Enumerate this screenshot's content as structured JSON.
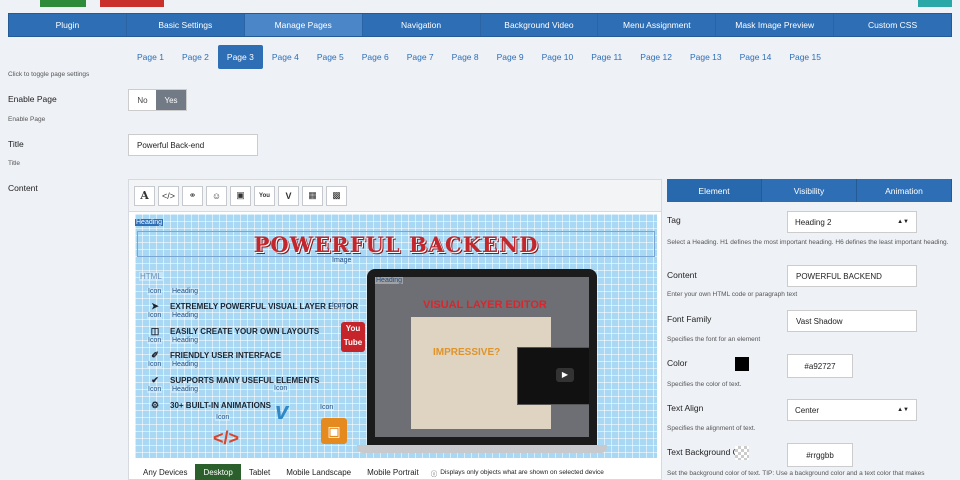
{
  "nav": {
    "items": [
      "Plugin",
      "Basic Settings",
      "Manage Pages",
      "Navigation",
      "Background Video",
      "Menu Assignment",
      "Mask Image Preview",
      "Custom CSS"
    ],
    "active_index": 2
  },
  "pages": {
    "items": [
      "Page 1",
      "Page 2",
      "Page 3",
      "Page 4",
      "Page 5",
      "Page 6",
      "Page 7",
      "Page 8",
      "Page 9",
      "Page 10",
      "Page 11",
      "Page 12",
      "Page 13",
      "Page 14",
      "Page 15"
    ],
    "active_index": 2,
    "toggle_hint": "Click to toggle page settings"
  },
  "form": {
    "enable_label": "Enable Page",
    "enable_help": "Enable Page",
    "no_label": "No",
    "yes_label": "Yes",
    "title_label": "Title",
    "title_value": "Powerful Back-end",
    "title_help": "Title",
    "content_label": "Content"
  },
  "canvas": {
    "heading_tag": "Heading",
    "heading_text": "POWERFUL BACKEND",
    "image_tag": "Image",
    "html_tag": "HTML",
    "icon_tag": "Icon",
    "features": [
      "EXTREMELY POWERFUL VISUAL LAYER EDITOR",
      "EASILY CREATE YOUR OWN LAYOUTS",
      "FRIENDLY USER INTERFACE",
      "SUPPORTS MANY USEFUL ELEMENTS",
      "30+ BUILT-IN ANIMATIONS"
    ],
    "screen_heading": "VISUAL LAYER EDITOR",
    "screen_impressive": "IMPRESSIVE?",
    "youtube_label": "You Tube"
  },
  "devices": {
    "items": [
      "Any Devices",
      "Desktop",
      "Tablet",
      "Mobile Landscape",
      "Mobile Portrait"
    ],
    "active_index": 1,
    "note": "Displays only objects what are shown on selected device"
  },
  "panel": {
    "tabs": [
      "Element",
      "Visibility",
      "Animation"
    ],
    "active_index": 0,
    "tag_label": "Tag",
    "tag_value": "Heading 2",
    "tag_help": "Select a Heading. H1 defines the most important heading. H6 defines the least important heading.",
    "content_label": "Content",
    "content_value": "POWERFUL BACKEND",
    "content_help": "Enter your own HTML code or paragraph text",
    "font_label": "Font Family",
    "font_value": "Vast Shadow",
    "font_help": "Specifies the font for an element",
    "color_label": "Color",
    "color_value": "#a92727",
    "color_help": "Specifies the color of text.",
    "align_label": "Text Align",
    "align_value": "Center",
    "align_help": "Specifies the alignment of text.",
    "bg_label": "Text Background C",
    "bg_value": "#rrggbb",
    "bg_help": "Set the background color of text. TIP: Use a background color and a text color that makes"
  },
  "colors": {
    "accent": "#2e6eb5",
    "heading": "#c2272d",
    "desktop_active": "#2b5f2b"
  }
}
